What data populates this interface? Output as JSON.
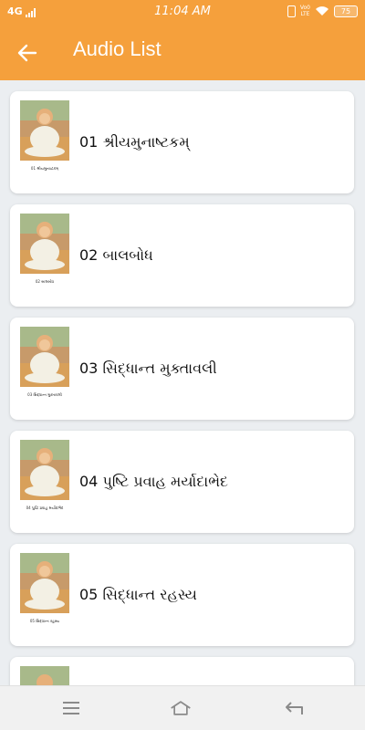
{
  "status_bar": {
    "network": "4G",
    "time": "11:04 AM",
    "volte": "Vo0\nLTE",
    "battery": "75"
  },
  "app_bar": {
    "title": "Audio List",
    "back_icon": "arrow-left-icon"
  },
  "audio_items": [
    {
      "title": "01 શ્રીયમુનાષ્ટકમ્",
      "caption": "01 શ્રીયમુનાષ્ટકમ્"
    },
    {
      "title": "02 બાલબોધ",
      "caption": "02 બાલબોધ"
    },
    {
      "title": "03 સિદ્ધાન્ત મુક્તાવલી",
      "caption": "03 સિદ્ધાન્ત મુક્તાવલી"
    },
    {
      "title": "04 પુષ્ટિ પ્રવાહ મર્યાદાભેદ",
      "caption": "04 પુષ્ટિ પ્રવાહ મર્યાદાભેદ"
    },
    {
      "title": "05 સિદ્ધાન્ત રહસ્ય",
      "caption": "05 સિદ્ધાન્ત રહસ્ય"
    }
  ],
  "nav_bar": {
    "icons": [
      "menu-icon",
      "home-icon",
      "back-icon"
    ]
  },
  "colors": {
    "accent": "#f5a03c",
    "background": "#ebeef1",
    "card": "#ffffff"
  }
}
